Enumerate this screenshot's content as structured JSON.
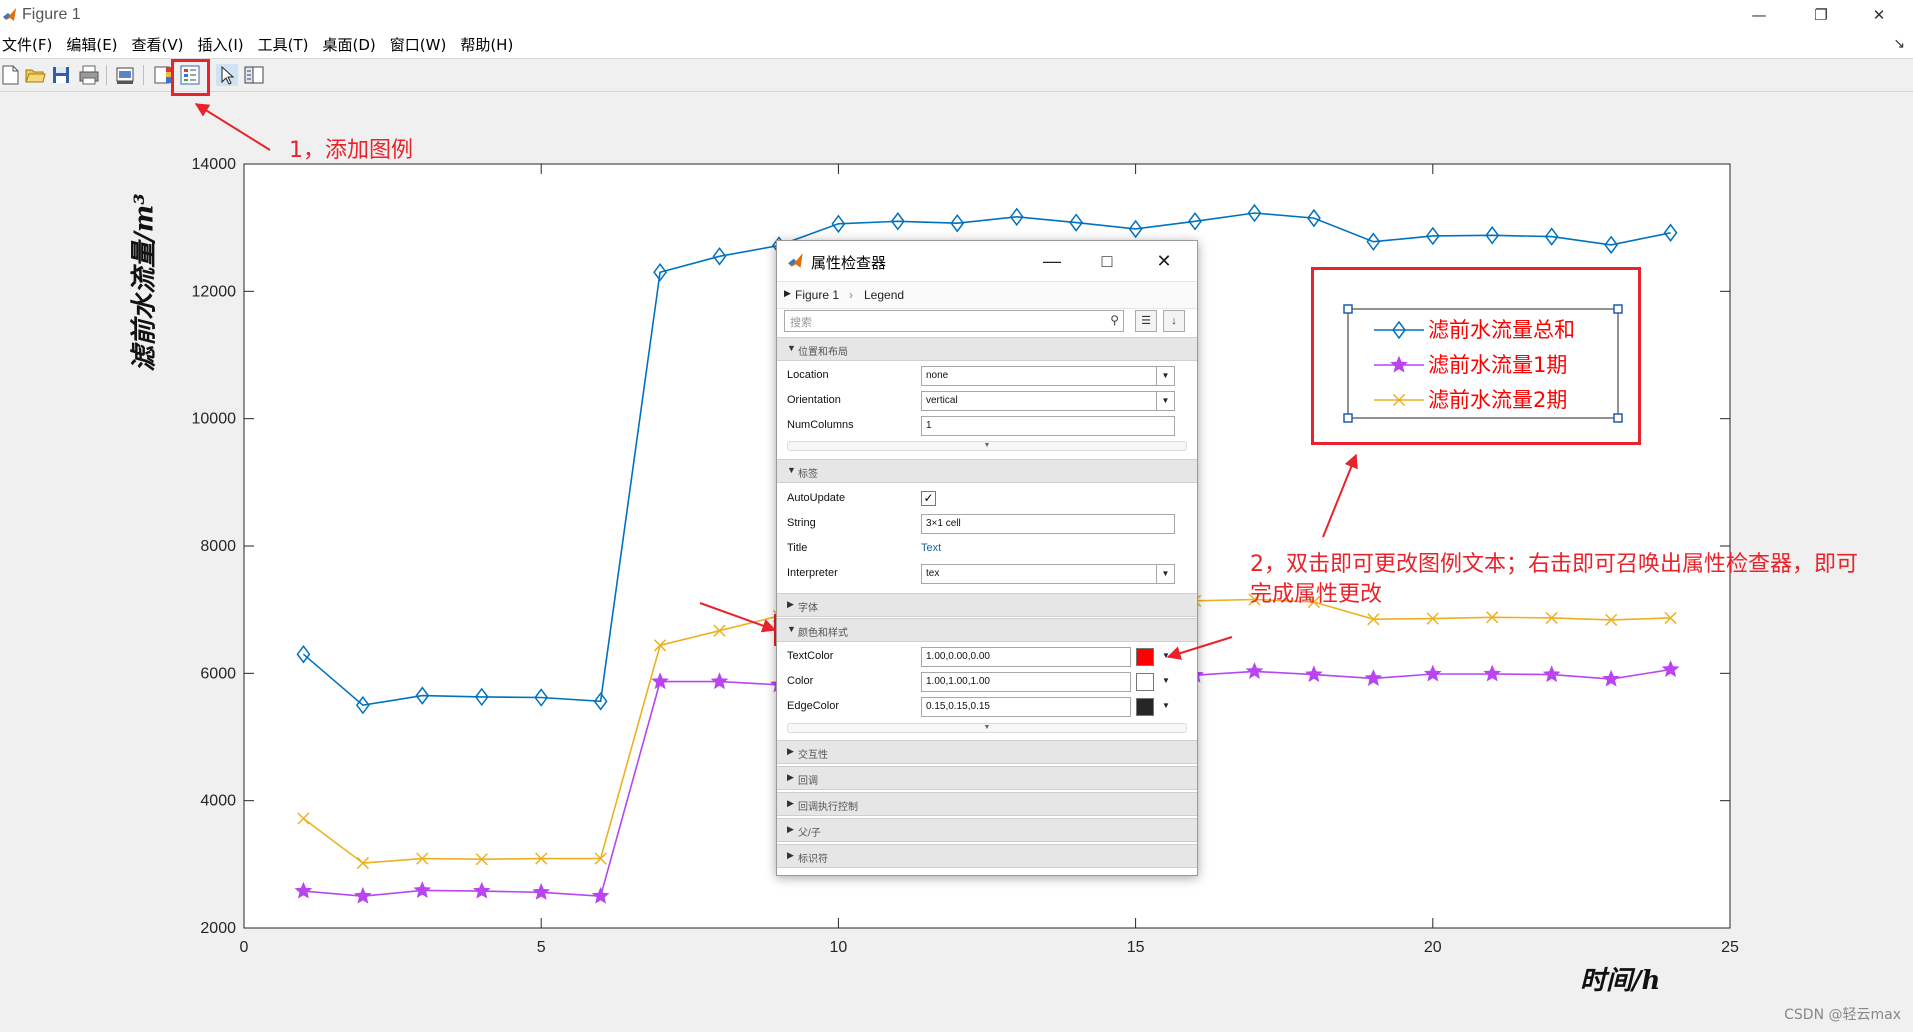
{
  "window": {
    "title": "Figure 1",
    "min_icon": "minimize-icon",
    "max_icon": "maximize-icon",
    "close_icon": "close-icon"
  },
  "menu": [
    "文件(F)",
    "编辑(E)",
    "查看(V)",
    "插入(I)",
    "工具(T)",
    "桌面(D)",
    "窗口(W)",
    "帮助(H)"
  ],
  "toolbar_icons": [
    "new-figure-icon",
    "open-file-icon",
    "save-icon",
    "print-icon",
    "link-plot-icon",
    "insert-colorbar-icon",
    "insert-legend-icon",
    "edit-plot-icon",
    "property-inspector-icon"
  ],
  "annotations": {
    "step1": "1，添加图例",
    "step2_line1": "2，双击即可更改图例文本；右击即可召唤出属性检查器，即可",
    "step2_line2": "完成属性更改",
    "color": "#e8232b"
  },
  "watermark": "CSDN @轻云max",
  "chart_data": {
    "type": "line",
    "xlabel": "时间/h",
    "ylabel": "滤前水流量/m³",
    "xlim": [
      0,
      25
    ],
    "ylim": [
      2000,
      14000
    ],
    "xticks": [
      0,
      5,
      10,
      15,
      20,
      25
    ],
    "yticks": [
      2000,
      4000,
      6000,
      8000,
      10000,
      12000,
      14000
    ],
    "x": [
      1,
      2,
      3,
      4,
      5,
      6,
      7,
      8,
      9,
      10,
      11,
      12,
      13,
      14,
      15,
      16,
      17,
      18,
      19,
      20,
      21,
      22,
      23,
      24
    ],
    "legend_position": "top-right",
    "series": [
      {
        "name": "滤前水流量总和",
        "color": "#0072bd",
        "marker": "diamond",
        "values": [
          6300,
          5500,
          5650,
          5630,
          5620,
          5560,
          12300,
          12550,
          12720,
          13060,
          13100,
          13070,
          13170,
          13080,
          12980,
          13100,
          13230,
          13150,
          12780,
          12870,
          12880,
          12860,
          12730,
          12920
        ]
      },
      {
        "name": "滤前水流量1期",
        "color": "#b845f0",
        "marker": "star",
        "values": [
          2580,
          2500,
          2590,
          2580,
          2560,
          2500,
          5870,
          5870,
          5820,
          5900,
          5930,
          5940,
          5960,
          5940,
          5980,
          5970,
          6030,
          5980,
          5920,
          5990,
          5990,
          5980,
          5910,
          6060
        ]
      },
      {
        "name": "滤前水流量2期",
        "color": "#edb120",
        "marker": "x",
        "values": [
          3720,
          3020,
          3090,
          3080,
          3090,
          3090,
          6440,
          6670,
          6900,
          7060,
          7100,
          7080,
          7140,
          7120,
          7090,
          7140,
          7160,
          7120,
          6850,
          6860,
          6880,
          6870,
          6840,
          6870
        ]
      }
    ]
  },
  "inspector": {
    "title": "属性检查器",
    "crumb_root": "Figure 1",
    "crumb_child": "Legend",
    "search_placeholder": "搜索",
    "sections": {
      "position": "位置和布局",
      "labels": "标签",
      "font": "字体",
      "color_style": "颜色和样式",
      "interactivity": "交互性",
      "callbacks": "回调",
      "callback_exec": "回调执行控制",
      "parent_child": "父/子",
      "identifiers": "标识符"
    },
    "props": {
      "location": {
        "name": "Location",
        "value": "none"
      },
      "orientation": {
        "name": "Orientation",
        "value": "vertical"
      },
      "numcolumns": {
        "name": "NumColumns",
        "value": "1"
      },
      "autoupdate": {
        "name": "AutoUpdate",
        "checked": "✓"
      },
      "string": {
        "name": "String",
        "value": "3×1 cell"
      },
      "title": {
        "name": "Title",
        "value": "Text"
      },
      "interpreter": {
        "name": "Interpreter",
        "value": "tex"
      },
      "textcolor": {
        "name": "TextColor",
        "value": "1.00,0.00,0.00",
        "swatch": "#ff0000"
      },
      "color": {
        "name": "Color",
        "value": "1.00,1.00,1.00",
        "swatch": "#ffffff"
      },
      "edgecolor": {
        "name": "EdgeColor",
        "value": "0.15,0.15,0.15",
        "swatch": "#262626"
      }
    }
  }
}
